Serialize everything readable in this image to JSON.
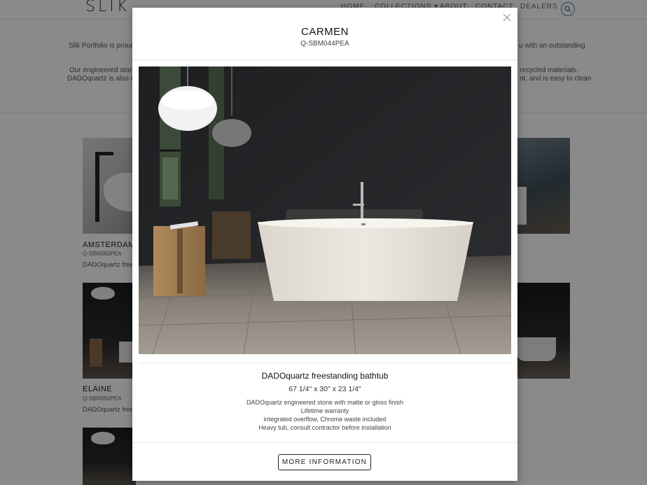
{
  "header": {
    "logo": "SLIK",
    "nav": {
      "home": "HOME",
      "collections": "COLLECTIONS ▾",
      "about": "ABOUT",
      "contact": "CONTACT",
      "dealers": "DEALERS"
    },
    "search_icon": "search-icon"
  },
  "intro": {
    "line1_left": "Slik Portfolio is proud",
    "line1_right": "u with an outstanding",
    "line2_left": "Our engineered stone",
    "line2_right": "m recycled materials.",
    "line3_left": "DADOquartz is also m",
    "line3_right": "nt, and is easy to clean"
  },
  "products": [
    {
      "title": "AMSTERDAM",
      "sku": "Q-SBM060PEA",
      "desc": "DADOquartz free"
    },
    {
      "title": "ELAINE",
      "sku": "Q-SBM050PEA",
      "desc": "DADOquartz free"
    }
  ],
  "modal": {
    "title": "CARMEN",
    "sku": "Q-SBM044PEA",
    "product_name": "DADOquartz freestanding bathtub",
    "dimensions": "67 1/4\" x 30\" x 23 1/4\"",
    "features": [
      "DADOquartz engineered stone with matte or gloss finish",
      "Lifetime warranty",
      "integrated overflow, Chrome waste included",
      "Heavy tub, consult contractor before installation"
    ],
    "more_button": "MORE INFORMATION",
    "close_icon": "close-icon"
  },
  "colors": {
    "overlay": "rgba(0,0,0,0.46)",
    "search_accent": "#4a7fa8"
  }
}
